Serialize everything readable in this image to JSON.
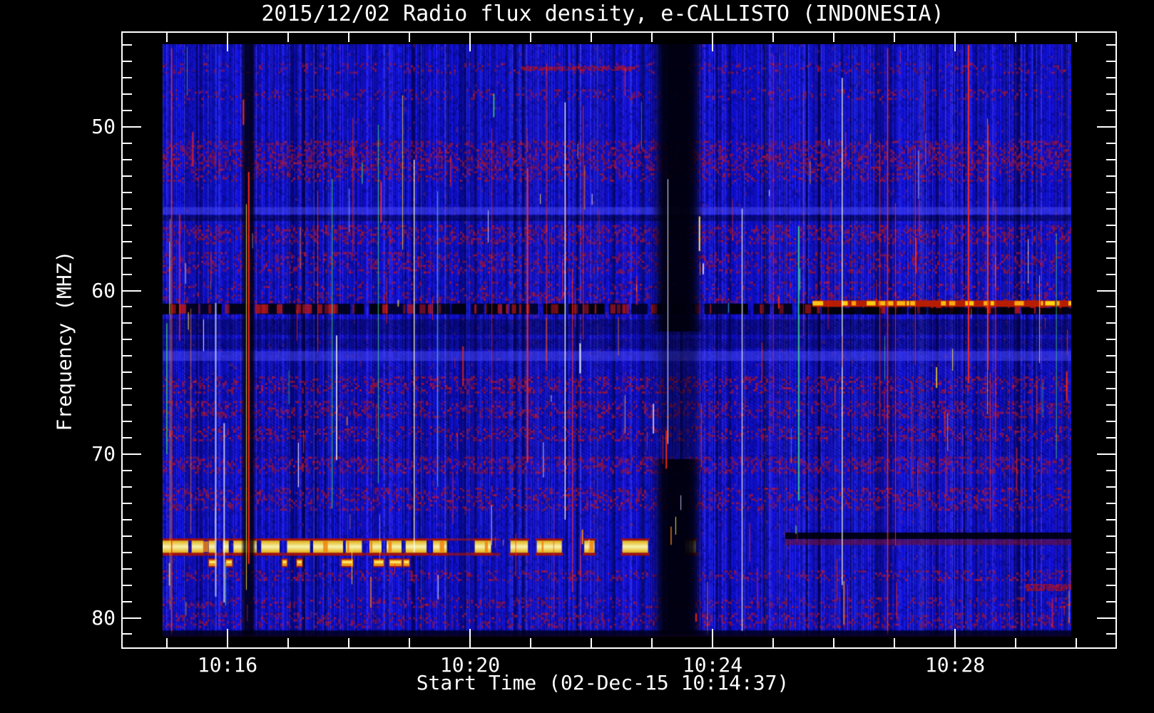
{
  "chart_data": {
    "type": "heatmap",
    "subtype": "radio-spectrogram",
    "title": "2015/12/02  Radio flux density, e-CALLISTO (INDONESIA)",
    "t_unit": "decimal minutes after 10:00 UT",
    "x_axis": {
      "label": "Start Time (02-Dec-15 10:14:37)",
      "major_ticks": [
        {
          "t": 16,
          "label": "10:16"
        },
        {
          "t": 20,
          "label": "10:20"
        },
        {
          "t": 24,
          "label": "10:24"
        },
        {
          "t": 28,
          "label": "10:28"
        }
      ],
      "minor_tick_interval_min": 1,
      "minor_range_min": [
        15,
        30
      ]
    },
    "y_axis": {
      "label": "Frequency (MHZ)",
      "major_ticks": [
        {
          "mhz": 50,
          "label": "50"
        },
        {
          "mhz": 60,
          "label": "60"
        },
        {
          "mhz": 70,
          "label": "70"
        },
        {
          "mhz": 80,
          "label": "80"
        }
      ],
      "minor_tick_interval_mhz": 1,
      "minor_range_mhz": [
        45,
        81
      ],
      "inverted": true
    },
    "image_extent": {
      "t0": 14.93,
      "t1": 29.92,
      "f0_mhz": 44.95,
      "f1_mhz": 81.15
    },
    "colormap": "deep blue background, dark-red mottled RFI rows, yellow/white saturated RFI, black dropouts",
    "background_color": "#1414be",
    "rfi_bands": [
      {
        "f0": 46.1,
        "f1": 46.7,
        "s": 0.28
      },
      {
        "f0": 47.7,
        "f1": 48.3,
        "s": 0.33
      },
      {
        "f0": 50.85,
        "f1": 52.55,
        "s": 0.7
      },
      {
        "f0": 52.7,
        "f1": 53.35,
        "s": 0.45
      },
      {
        "f0": 56.0,
        "f1": 57.15,
        "s": 0.6
      },
      {
        "f0": 57.65,
        "f1": 58.9,
        "s": 0.5
      },
      {
        "f0": 59.45,
        "f1": 59.9,
        "s": 0.3
      },
      {
        "f0": 60.1,
        "f1": 60.65,
        "s": 0.35
      },
      {
        "f0": 65.25,
        "f1": 66.2,
        "s": 0.55
      },
      {
        "f0": 66.75,
        "f1": 67.7,
        "s": 0.55
      },
      {
        "f0": 68.3,
        "f1": 69.1,
        "s": 0.5
      },
      {
        "f0": 70.15,
        "f1": 71.1,
        "s": 0.65
      },
      {
        "f0": 72.05,
        "f1": 72.75,
        "s": 0.5
      },
      {
        "f0": 72.8,
        "f1": 73.4,
        "s": 0.45
      },
      {
        "f0": 77.1,
        "f1": 77.7,
        "s": 0.45
      },
      {
        "f0": 78.75,
        "f1": 79.3,
        "s": 0.4
      },
      {
        "f0": 79.7,
        "f1": 80.6,
        "s": 0.45
      }
    ],
    "light_bands": [
      {
        "f0": 54.9,
        "f1": 55.35
      },
      {
        "f0": 63.7,
        "f1": 64.3
      }
    ],
    "dark_rows": [
      {
        "f0": 55.4,
        "f1": 55.75,
        "s": 0.4
      },
      {
        "f0": 61.75,
        "f1": 62.7,
        "s": 0.3
      },
      {
        "f0": 62.95,
        "f1": 63.55,
        "s": 0.22
      },
      {
        "f0": 80.75,
        "f1": 81.15,
        "s": 0.55
      }
    ],
    "features": {
      "bright_band": {
        "f0": 75.15,
        "f1": 76.2,
        "t0": 14.93,
        "t1": 22.95,
        "late_segment_times": [
          23.55,
          23.63
        ],
        "colors": {
          "core": "#f7f3ae",
          "edge": "#e2ae10",
          "border": "#a11111",
          "patch": "#f0820a"
        }
      },
      "sub_blobs": {
        "f0": 76.36,
        "f1": 76.92,
        "times": [
          15.68,
          15.96,
          16.89,
          17.13,
          17.87,
          18.4,
          18.66,
          18.89
        ]
      },
      "blanked_channel": {
        "f0": 60.8,
        "f1": 61.45,
        "t0": 14.93,
        "t1": 29.92
      },
      "carrier": {
        "f0": 60.6,
        "f1": 61.0,
        "t0": 25.65,
        "t1": 29.92,
        "colors": {
          "base": "#b71e00",
          "dash": "#ffc818"
        }
      },
      "dark_channel": {
        "f0": 74.79,
        "f1": 75.18,
        "t0": 25.2,
        "t1": 29.92,
        "maroon_f0": 75.2,
        "maroon_f1": 75.55
      },
      "red_segments": [
        {
          "f0": 46.3,
          "f1": 46.56,
          "t0": 20.84,
          "t1": 22.72
        },
        {
          "f0": 77.93,
          "f1": 78.28,
          "t0": 29.15,
          "t1": 29.92
        }
      ],
      "dropout_bands": [
        {
          "t0": 16.22,
          "t1": 16.47,
          "s": 0.8,
          "weak_mid": false
        },
        {
          "t0": 23.0,
          "t1": 23.85,
          "s": 0.85,
          "weak_mid": true
        }
      ],
      "vertical_lines": [
        {
          "t": 15.07,
          "f0": 45.2,
          "f1": 81.0,
          "color": "#ff2a14"
        },
        {
          "t": 19.07,
          "f0": 52.0,
          "f1": 76.0,
          "color": "#ffffff"
        },
        {
          "t": 21.56,
          "f0": 48.5,
          "f1": 74.0,
          "color": "#ffffff"
        },
        {
          "t": 24.48,
          "f0": 55.0,
          "f1": 80.8,
          "color": "#e8e8ff"
        },
        {
          "t": 26.13,
          "f0": 47.0,
          "f1": 78.0,
          "color": "#ffffff"
        },
        {
          "t": 26.88,
          "f0": 45.2,
          "f1": 81.0,
          "color": "#ff3314"
        },
        {
          "t": 14.99,
          "f0": 62.0,
          "f1": 70.0,
          "color": "#3ed06a"
        }
      ]
    }
  }
}
